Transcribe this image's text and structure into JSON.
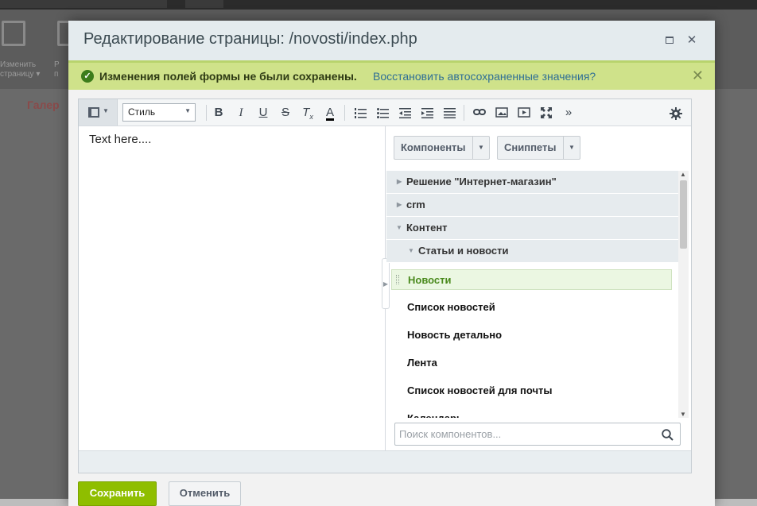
{
  "background": {
    "toolbar_items": [
      {
        "line1": "Изменить",
        "line2": "страницу ▾"
      },
      {
        "line1": "Р",
        "line2": "п"
      }
    ],
    "content_link": "Галер"
  },
  "dialog": {
    "title": "Редактирование страницы: /novosti/index.php",
    "expand_icon": "expand-icon",
    "close_glyph": "✕"
  },
  "notice": {
    "check_glyph": "✓",
    "text": "Изменения полей формы не были сохранены.",
    "link": "Восстановить автосохраненные значения?",
    "close_glyph": "✕"
  },
  "toolbar": {
    "style_select_value": "Стиль",
    "buttons": {
      "bold": "B",
      "italic": "I",
      "underline": "U",
      "strike": "S",
      "clear_format": "T",
      "clear_format_sub": "x",
      "font_color": "A",
      "more": "»"
    }
  },
  "editor": {
    "text": "Text here...."
  },
  "panel": {
    "components_button": "Компоненты",
    "snippets_button": "Сниппеты",
    "tree": [
      {
        "label": "Решение \"Интернет-магазин\"",
        "expanded": false
      },
      {
        "label": "crm",
        "expanded": false
      },
      {
        "label": "Контент",
        "expanded": true
      },
      {
        "label": "Статьи и новости",
        "expanded": true
      }
    ],
    "components": [
      "Новости",
      "Список новостей",
      "Новость детально",
      "Лента",
      "Список новостей для почты",
      "Календарь"
    ],
    "search_placeholder": "Поиск компонентов..."
  },
  "footer": {
    "save_button": "Сохранить",
    "cancel_button": "Отменить"
  },
  "colors": {
    "notice_bg": "#cfe28a",
    "save_bg": "#8fbe00",
    "link": "#2f6f95",
    "active_component": "#4a8a1d"
  }
}
